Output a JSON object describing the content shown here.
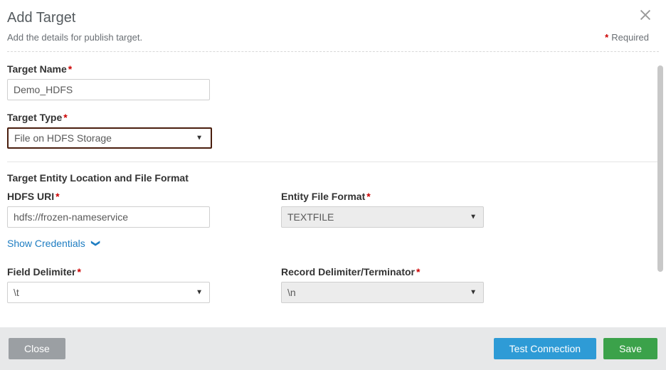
{
  "dialog": {
    "title": "Add Target",
    "subtitle": "Add the details for publish target.",
    "required_label": "Required"
  },
  "form": {
    "target_name": {
      "label": "Target Name",
      "value": "Demo_HDFS"
    },
    "target_type": {
      "label": "Target Type",
      "value": "File on HDFS Storage"
    },
    "section_location": "Target Entity Location and File Format",
    "hdfs_uri": {
      "label": "HDFS URI",
      "value": "hdfs://frozen-nameservice"
    },
    "entity_file_format": {
      "label": "Entity File Format",
      "value": "TEXTFILE"
    },
    "show_credentials": "Show Credentials",
    "field_delimiter": {
      "label": "Field Delimiter",
      "value": "\\t"
    },
    "record_delimiter": {
      "label": "Record Delimiter/Terminator",
      "value": "\\n"
    }
  },
  "footer": {
    "close": "Close",
    "test": "Test Connection",
    "save": "Save"
  }
}
